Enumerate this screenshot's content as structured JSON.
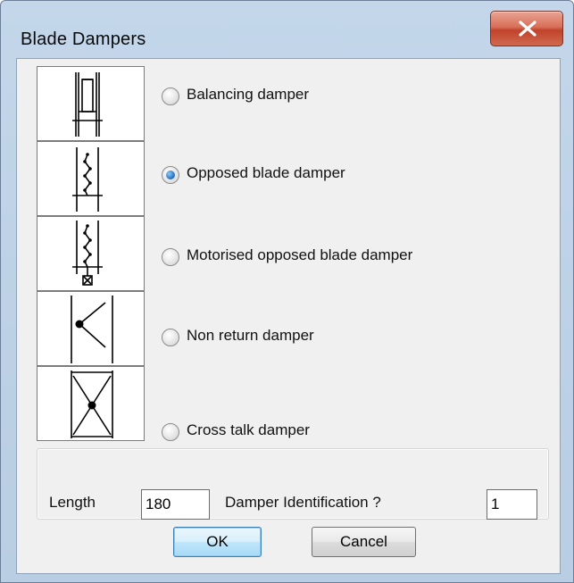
{
  "window": {
    "title": "Blade Dampers",
    "close_glyph": "x"
  },
  "options": [
    {
      "label": "Balancing damper",
      "checked": false,
      "icon": "balancing-damper-icon"
    },
    {
      "label": "Opposed blade damper",
      "checked": true,
      "icon": "opposed-blade-damper-icon"
    },
    {
      "label": "Motorised opposed blade damper",
      "checked": false,
      "icon": "motorised-damper-icon"
    },
    {
      "label": "Non return damper",
      "checked": false,
      "icon": "non-return-damper-icon"
    },
    {
      "label": "Cross talk damper",
      "checked": false,
      "icon": "cross-talk-damper-icon"
    }
  ],
  "fields": {
    "length_label": "Length",
    "length_value": "180",
    "damper_id_label": "Damper Identification ?",
    "damper_id_value": "1"
  },
  "buttons": {
    "ok": "OK",
    "cancel": "Cancel"
  },
  "colors": {
    "title_bar": "#c3d6ea",
    "close_button": "#c8503a",
    "client": "#f0f0f0",
    "radio_checked": "#1d6bbf"
  }
}
